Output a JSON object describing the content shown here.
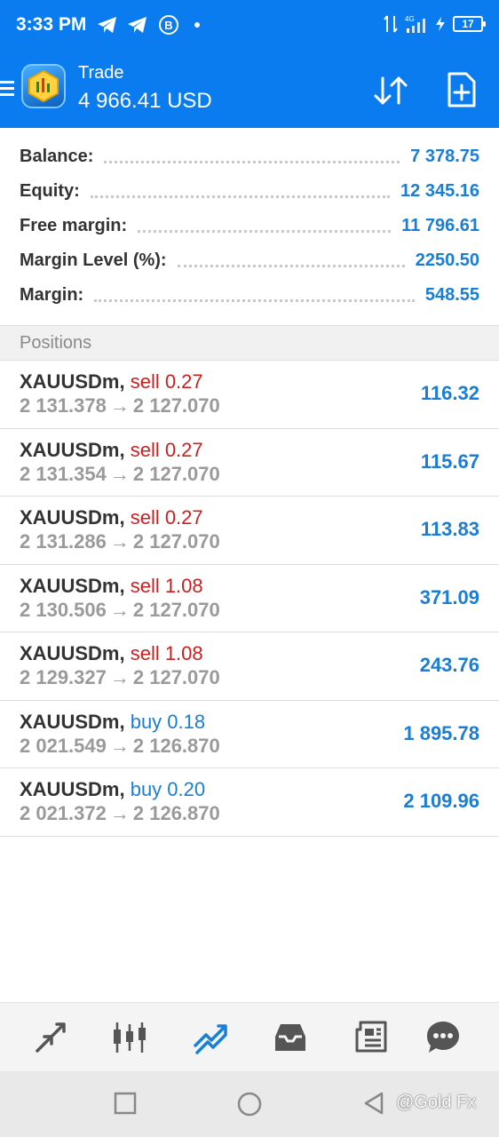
{
  "status_bar": {
    "time": "3:33 PM",
    "network": "4G",
    "battery": "17",
    "icons": [
      "telegram-icon",
      "telegram-icon",
      "b-circle-icon",
      "dot-icon",
      "signal-icon",
      "charging-icon"
    ]
  },
  "app_bar": {
    "title": "Trade",
    "subtitle": "4 966.41 USD",
    "icons": [
      "menu-icon",
      "app-logo",
      "sort-icon",
      "new-order-icon"
    ]
  },
  "summary": [
    {
      "label": "Balance:",
      "value": "7 378.75"
    },
    {
      "label": "Equity:",
      "value": "12 345.16"
    },
    {
      "label": "Free margin:",
      "value": "11 796.61"
    },
    {
      "label": "Margin Level (%):",
      "value": "2250.50"
    },
    {
      "label": "Margin:",
      "value": "548.55"
    }
  ],
  "section_title": "Positions",
  "positions": [
    {
      "symbol": "XAUUSDm,",
      "side": "sell 0.27",
      "open": "2 131.378",
      "arrow": "→",
      "current": "2 127.070",
      "profit": "116.32"
    },
    {
      "symbol": "XAUUSDm,",
      "side": "sell 0.27",
      "open": "2 131.354",
      "arrow": "→",
      "current": "2 127.070",
      "profit": "115.67"
    },
    {
      "symbol": "XAUUSDm,",
      "side": "sell 0.27",
      "open": "2 131.286",
      "arrow": "→",
      "current": "2 127.070",
      "profit": "113.83"
    },
    {
      "symbol": "XAUUSDm,",
      "side": "sell 1.08",
      "open": "2 130.506",
      "arrow": "→",
      "current": "2 127.070",
      "profit": "371.09"
    },
    {
      "symbol": "XAUUSDm,",
      "side": "sell 1.08",
      "open": "2 129.327",
      "arrow": "→",
      "current": "2 127.070",
      "profit": "243.76"
    },
    {
      "symbol": "XAUUSDm,",
      "side": "buy 0.18",
      "open": "2 021.549",
      "arrow": "→",
      "current": "2 126.870",
      "profit": "1 895.78"
    },
    {
      "symbol": "XAUUSDm,",
      "side": "buy 0.20",
      "open": "2 021.372",
      "arrow": "→",
      "current": "2 126.870",
      "profit": "2 109.96"
    }
  ],
  "bottom_nav": [
    "quotes-icon",
    "chart-icon",
    "trade-icon",
    "history-icon",
    "news-icon",
    "chat-icon"
  ],
  "system_nav": [
    "recents-icon",
    "home-icon",
    "back-icon"
  ],
  "watermark": "@Gold Fx",
  "colors": {
    "header": "#0a7cf0",
    "value": "#1a7fd4",
    "sell": "#cc2020",
    "buy": "#1a7fd4",
    "active_tab": "#1a7fd4"
  }
}
